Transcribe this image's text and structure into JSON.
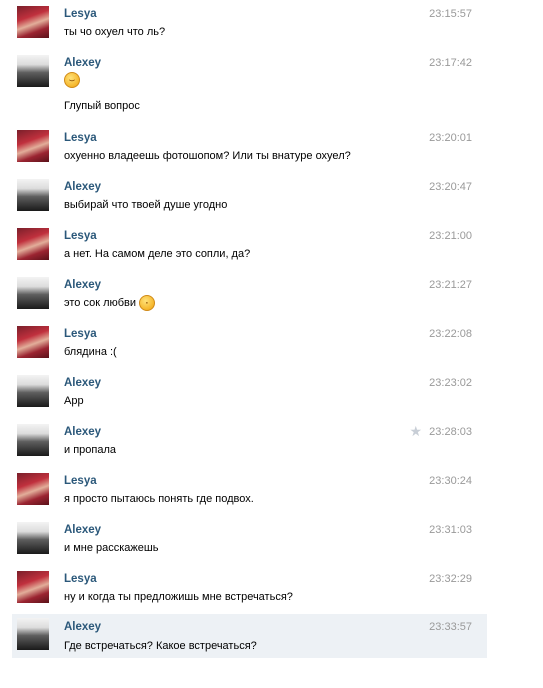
{
  "messages": [
    {
      "author": "Lesya",
      "time": "23:15:57",
      "text": "ты чо охуел что ль?",
      "avatar": "lesya"
    },
    {
      "author": "Alexey",
      "time": "23:17:42",
      "emoji": "laughing-emoji",
      "text": "Глупый вопрос",
      "avatar": "alexey"
    },
    {
      "author": "Lesya",
      "time": "23:20:01",
      "text": "охуенно владеешь фотошопом? Или ты внатуре охуел?",
      "avatar": "lesya"
    },
    {
      "author": "Alexey",
      "time": "23:20:47",
      "text": "выбирай что твоей душе угодно",
      "avatar": "alexey"
    },
    {
      "author": "Lesya",
      "time": "23:21:00",
      "text": "а нет. На самом деле это сопли, да?",
      "avatar": "lesya"
    },
    {
      "author": "Alexey",
      "time": "23:21:27",
      "text": "это сок любви",
      "emoji_inline": "kissing-emoji",
      "avatar": "alexey"
    },
    {
      "author": "Lesya",
      "time": "23:22:08",
      "text": "блядина :(",
      "avatar": "lesya"
    },
    {
      "author": "Alexey",
      "time": "23:23:02",
      "text": "Арр",
      "avatar": "alexey"
    },
    {
      "author": "Alexey",
      "time": "23:28:03",
      "text": "и пропала",
      "avatar": "alexey",
      "starred": true
    },
    {
      "author": "Lesya",
      "time": "23:30:24",
      "text": "я просто пытаюсь понять где подвох.",
      "avatar": "lesya"
    },
    {
      "author": "Alexey",
      "time": "23:31:03",
      "text": "и мне расскажешь",
      "avatar": "alexey"
    },
    {
      "author": "Lesya",
      "time": "23:32:29",
      "text": "ну и когда ты предложишь мне встречаться?",
      "avatar": "lesya"
    },
    {
      "author": "Alexey",
      "time": "23:33:57",
      "text": "Где встречаться? Какое встречаться?",
      "avatar": "alexey",
      "highlighted": true
    }
  ],
  "colors": {
    "author": "#2b587a",
    "time": "#999999",
    "highlight": "#edf1f5"
  }
}
